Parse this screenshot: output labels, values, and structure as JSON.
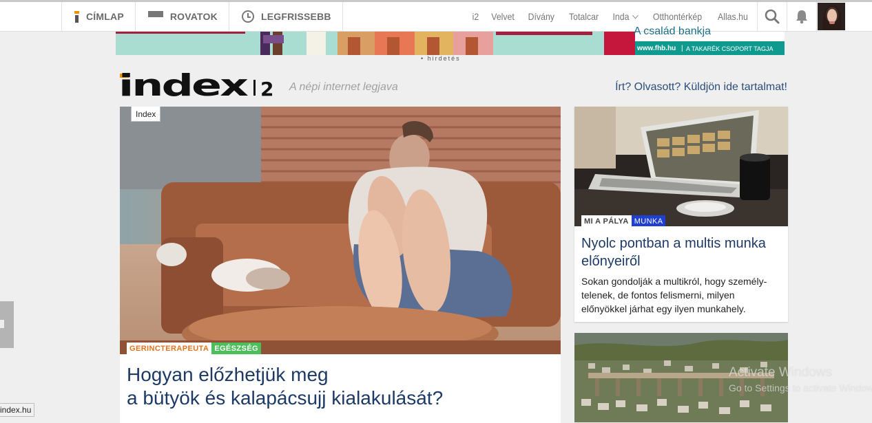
{
  "nav": {
    "cimlap": "CÍMLAP",
    "rovatok": "ROVATOK",
    "legfrissebb": "LEGFRISSEBB",
    "sites": [
      "i2",
      "Velvet",
      "Dívány",
      "Totalcar",
      "Inda",
      "Otthontérkép",
      "Allas.hu"
    ]
  },
  "ad": {
    "slogan": "A család bankja",
    "url": "www.fhb.hu",
    "group": "A TAKARÉK CSOPORT TAGJA",
    "label": "hirdetés"
  },
  "brand": {
    "logo": "index",
    "section": "2",
    "tagline": "A népi internet legjava",
    "cta": "Írt? Olvasott? Küldjön ide tartalmat!"
  },
  "main_article": {
    "source_tag": "Index",
    "labels": [
      "GERINCTERAPEUTA",
      "EGÉSZSÉG"
    ],
    "title_line1": "Hogyan előzhetjük meg",
    "title_line2": "a bütyök és kalapácsujj kialakulását?"
  },
  "side_article": {
    "labels": [
      "MI A PÁLYA",
      "MUNKA"
    ],
    "title": "Nyolc pontban a multis munka előnyeiről",
    "lead": "Sokan gondolják a multikról, hogy személy-telenek, de fontos felismerni, milyen előnyökkel járhat egy ilyen munkahely."
  },
  "status_url": "index.hu",
  "watermark": {
    "line1": "Activate Windows",
    "line2": "Go to Settings to activate Windows."
  },
  "colors": {
    "accent_orange": "#f39200",
    "title_blue": "#1d3a66",
    "label_green": "#4cbf5a",
    "label_blue": "#1f3fd0",
    "label_orange": "#e2731b"
  }
}
